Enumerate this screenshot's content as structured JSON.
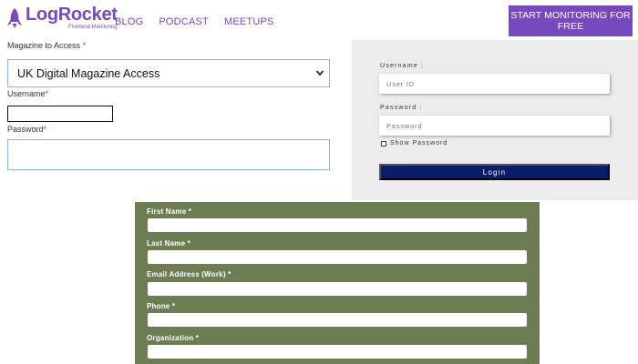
{
  "header": {
    "logo_text": "LogRocket",
    "logo_subtitle": "Frontend Monitoring",
    "nav": [
      "BLOG",
      "PODCAST",
      "MEETUPS"
    ],
    "cta_label": "START MONITORING FOR FREE",
    "brand_color": "#764abc"
  },
  "left_form": {
    "magazine_label": "Magazine to Access",
    "required_mark": "*",
    "magazine_value": "UK Digital Magazine Access",
    "username_label": "Username",
    "username_mark": "*",
    "password_label": "Password",
    "password_mark": "*"
  },
  "login_panel": {
    "username_label": "Username :",
    "username_placeholder": "User ID",
    "password_label": "Password :",
    "password_placeholder": "Password",
    "show_password_label": "Show Password",
    "login_label": "Login",
    "button_color": "#0b1c6b"
  },
  "green_form": {
    "color": "#6e7c54",
    "fields": [
      "First Name *",
      "Last Name *",
      "Email Address (Work) *",
      "Phone *",
      "Organization *"
    ]
  }
}
